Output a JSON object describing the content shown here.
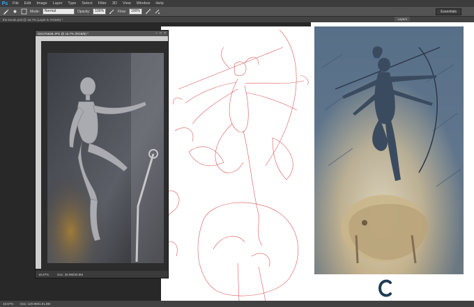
{
  "app": {
    "logo": "Ps"
  },
  "menu": [
    "File",
    "Edit",
    "Image",
    "Layer",
    "Type",
    "Select",
    "Filter",
    "3D",
    "View",
    "Window",
    "Help"
  ],
  "options": {
    "mode_label": "Mode:",
    "mode_value": "Normal",
    "opacity_label": "Opacity:",
    "opacity_value": "100%",
    "flow_label": "Flow:",
    "flow_value": "100%",
    "workspace": "Essentials"
  },
  "doc_tab": {
    "title": "the knook.psd @ 16.7% (Layer 8, RGB/8) *"
  },
  "panels": {
    "layers_tab": "Layers"
  },
  "doc_window": {
    "title": "DSCF5638.JPG @ 16.7% (RGB/8) *",
    "zoom": "16.67%",
    "doc_info": "Doc: 30.9M/30.9M"
  },
  "status": {
    "zoom": "16.67%",
    "doc_info": "Doc: 120.9M/1.51.8M"
  },
  "colors": {
    "menubar": "#3c3c3c",
    "optionsbar": "#535353",
    "canvas_bg": "#282828",
    "sketch_line": "#d64545",
    "painting_blue": "#4a6383",
    "painting_gold": "#d9c190"
  },
  "icons": [
    "brush-icon",
    "minimize-icon",
    "maximize-icon",
    "close-icon",
    "airbrush-icon",
    "pressure-icon"
  ]
}
